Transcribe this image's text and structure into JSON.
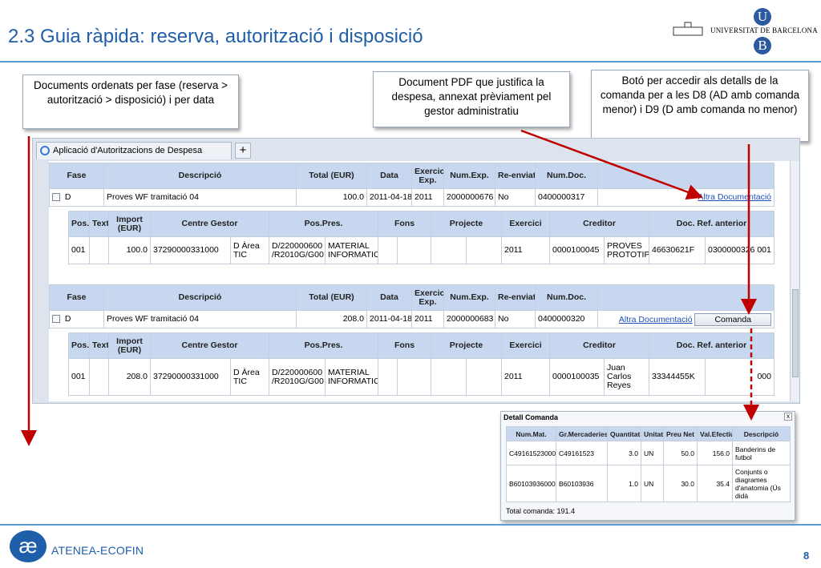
{
  "slide": {
    "title": "2.3 Guia ràpida: reserva, autorització i disposició",
    "page_number": "8",
    "brand_name": "ATENEA-ECOFIN",
    "university_name": "UNIVERSITAT DE BARCELONA",
    "colors": {
      "title": "#1f5ea8",
      "arrow": "#c00000",
      "header_bg": "#c6d7ef"
    }
  },
  "callouts": {
    "left": "Documents ordenats per fase (reserva > autorització > disposició) i per data",
    "middle": "Document PDF que justifica la despesa, annexat prèviament pel gestor administratiu",
    "right": "Botó per accedir als detalls de la comanda per a les D8 (AD amb comanda menor) i D9 (D amb comanda no menor)"
  },
  "app": {
    "tab_label": "Aplicació d'Autoritzacions de Despesa",
    "tab_add": "+",
    "main_headers": [
      "Fase",
      "Descripció",
      "Total (EUR)",
      "Data",
      "Exercici Exp.",
      "Num.Exp.",
      "Re-enviat",
      "Num.Doc.",
      ""
    ],
    "detail_headers": [
      "Pos.",
      "Text",
      "Import (EUR)",
      "Centre Gestor",
      "Pos.Pres.",
      "Fons",
      "Projecte",
      "Exercici",
      "Creditor",
      "Doc. Ref. anterior"
    ],
    "records": [
      {
        "fase": "D",
        "descripcio": "Proves WF tramitació 04",
        "total": "100.0",
        "data": "2011-04-18",
        "exercici": "2011",
        "num_exp": "2000000676",
        "reenviat": "No",
        "num_doc": "0400000317",
        "link": "Altra Documentació",
        "detail": {
          "pos": "001",
          "text": "",
          "import": "100.0",
          "centre": "37290000331000",
          "centre_desc": "D Àrea TIC",
          "pospres": "D/220000600 /R2010G/G00",
          "pospres_desc": "MATERIAL INFORMATIC",
          "fons": "",
          "projecte": "",
          "exercici": "2011",
          "creditor": "0000100045",
          "creditor_name": "PROVES PROTOTIPUS",
          "nif": "46630621F",
          "docref": "0300000326",
          "docref_pos": "001"
        }
      },
      {
        "fase": "D",
        "descripcio": "Proves WF tramitació 04",
        "total": "208.0",
        "data": "2011-04-18",
        "exercici": "2011",
        "num_exp": "2000000683",
        "reenviat": "No",
        "num_doc": "0400000320",
        "link": "Altra Documentació",
        "button": "Comanda",
        "detail": {
          "pos": "001",
          "text": "",
          "import": "208.0",
          "centre": "37290000331000",
          "centre_desc": "D Àrea TIC",
          "pospres": "D/220000600 /R2010G/G00",
          "pospres_desc": "MATERIAL INFORMATIC",
          "fons": "",
          "projecte": "",
          "exercici": "2011",
          "creditor": "0000100035",
          "creditor_name": "Juan Carlos Reyes",
          "nif": "33344455K",
          "docref": "",
          "docref_pos": "000"
        }
      }
    ]
  },
  "popup": {
    "title": "Detall Comanda",
    "close": "x",
    "headers": [
      "Num.Mat.",
      "Gr.Mercaderies",
      "Quantitat",
      "Unitat",
      "Preu Net",
      "Val.Efectiu",
      "Descripció"
    ],
    "rows": [
      [
        "C49161523000",
        "C49161523",
        "3.0",
        "UN",
        "50.0",
        "156.0",
        "Banderins de futbol"
      ],
      [
        "B60103936000",
        "B60103936",
        "1.0",
        "UN",
        "30.0",
        "35.4",
        "Conjunts o diagrames d'anatomia (Ús didà"
      ]
    ],
    "total": "Total comanda: 191.4"
  }
}
